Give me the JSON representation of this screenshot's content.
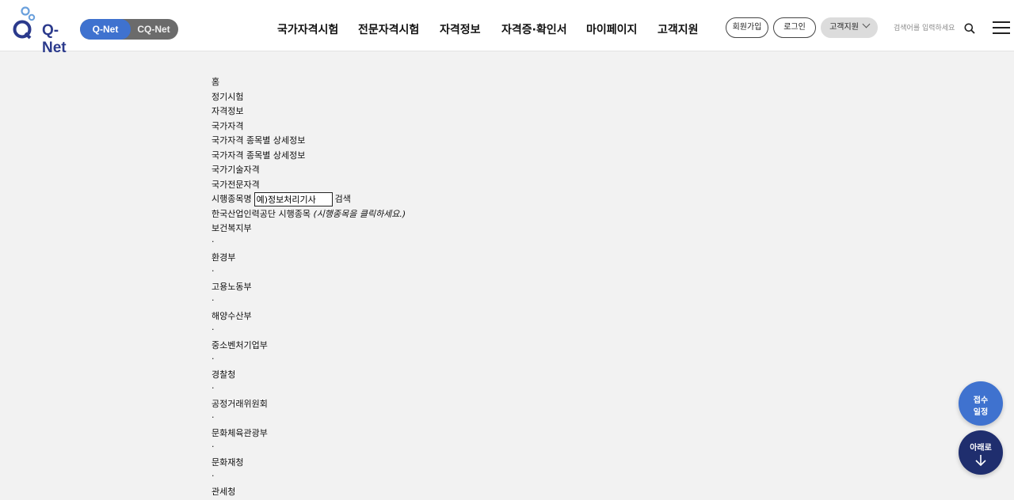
{
  "header": {
    "logo_text": "Q-Net",
    "site_toggle": {
      "active": "Q-Net",
      "inactive": "CQ-Net"
    },
    "nav": [
      "국가자격시험",
      "전문자격시험",
      "자격정보",
      "자격증·확인서",
      "마이페이지",
      "고객지원"
    ],
    "signup": "회원가입",
    "login": "로그인",
    "support_dropdown": "고객지원",
    "search_placeholder": "검색어를 입력하세요",
    "icons": {
      "search": "search-icon",
      "menu": "hamburger-menu-icon",
      "dropdown": "chevron-down-icon"
    },
    "colors": {
      "brand_blue": "#3f72cf",
      "navy": "#1f2e6e"
    }
  },
  "breadcrumb": [
    "홈",
    "정기시험",
    "자격정보",
    "국가자격",
    "국가자격 종목별 상세정보",
    "국가자격 종목별 상세정보",
    "국가기술자격",
    "국가전문자격"
  ],
  "search": {
    "label": "시행종목명",
    "value": "예)정보처리기사",
    "button": "검색"
  },
  "agency": {
    "title": "한국산업인력공단 시행종목",
    "hint": "(시행종목을 클릭하세요.)"
  },
  "ministries": [
    "보건복지부",
    "환경부",
    "고용노동부",
    "해양수산부",
    "중소벤처기업부",
    "경찰청",
    "공정거래위원회",
    "문화체육관광부",
    "문화재청",
    "관세청"
  ],
  "separator": "·",
  "floating": {
    "schedule": [
      "접수",
      "일정"
    ],
    "down": "아래로"
  }
}
